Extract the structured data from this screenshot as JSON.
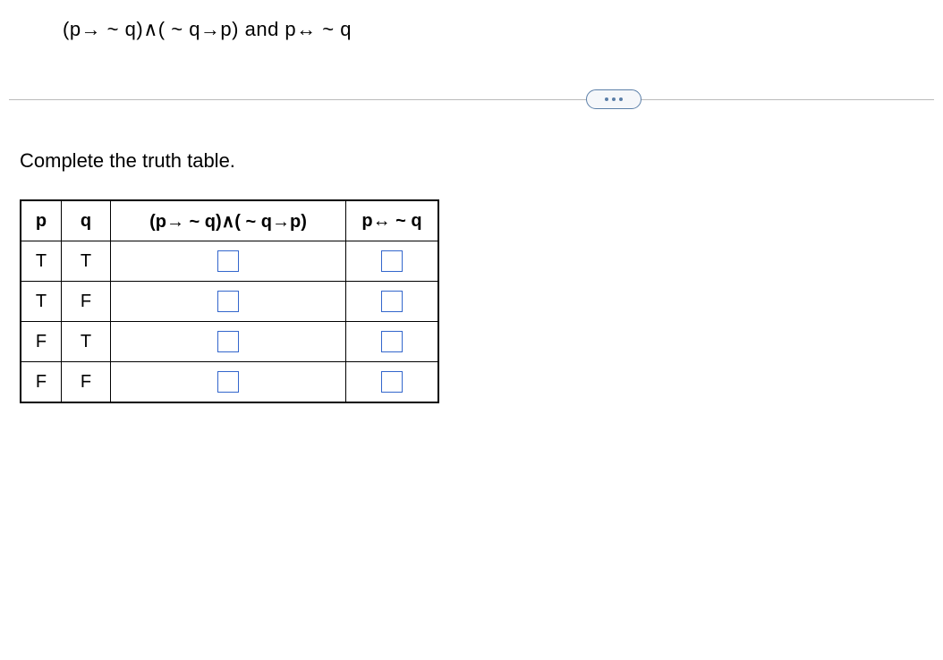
{
  "formula": "(p→ ~ q)∧( ~ q→p) and p↔ ~ q",
  "instruction": "Complete the truth table.",
  "table": {
    "headers": [
      "p",
      "q",
      "(p→ ~ q)∧( ~ q→p)",
      "p↔ ~ q"
    ],
    "rows": [
      {
        "p": "T",
        "q": "T"
      },
      {
        "p": "T",
        "q": "F"
      },
      {
        "p": "F",
        "q": "T"
      },
      {
        "p": "F",
        "q": "F"
      }
    ]
  }
}
